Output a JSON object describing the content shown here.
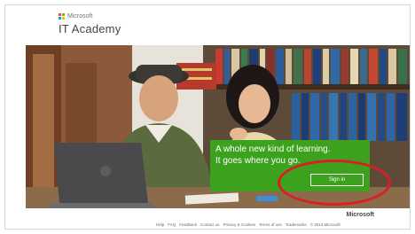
{
  "header": {
    "brand": "Microsoft",
    "site_title": "IT Academy",
    "logo_colors": [
      "#f25022",
      "#7fba00",
      "#00a4ef",
      "#ffb900"
    ]
  },
  "hero": {
    "headline_1": "A whole new kind of learning.",
    "headline_2": "It goes where you go.",
    "signin_label": "Sign in",
    "accent": "#3ca21e",
    "highlight_color": "#d91f26"
  },
  "footer": {
    "brand": "Microsoft",
    "links": [
      "Help",
      "FAQ",
      "Feedback",
      "Contact us",
      "Privacy & Cookies",
      "Terms of use",
      "Trademarks"
    ],
    "copyright": "© 2013 Microsoft"
  }
}
